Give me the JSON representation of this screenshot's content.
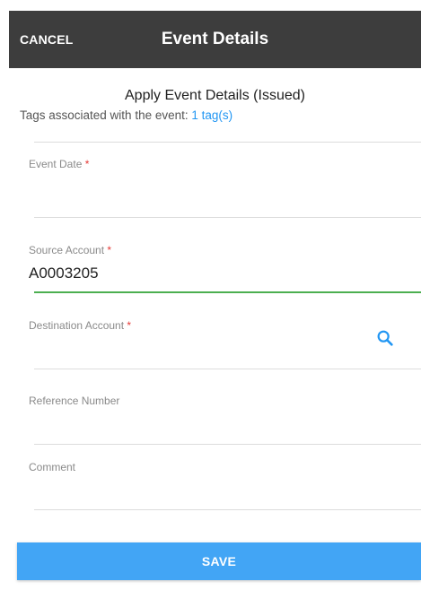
{
  "header": {
    "cancel_label": "CANCEL",
    "title": "Event Details"
  },
  "content": {
    "subtitle": "Apply Event Details (Issued)",
    "tags_prefix": "Tags associated with the event: ",
    "tags_link": "1 tag(s)"
  },
  "fields": {
    "event_date": {
      "label": "Event Date",
      "required_mark": "*",
      "value": ""
    },
    "source_account": {
      "label": "Source Account",
      "required_mark": "*",
      "value": "A0003205"
    },
    "destination_account": {
      "label": "Destination Account",
      "required_mark": "*",
      "value": "",
      "icon": "search-icon"
    },
    "reference_number": {
      "label": "Reference Number",
      "value": ""
    },
    "comment": {
      "label": "Comment",
      "value": ""
    }
  },
  "footer": {
    "save_label": "SAVE"
  },
  "colors": {
    "header_bg": "#3d3d3d",
    "accent": "#2196f3",
    "button": "#42a5f5",
    "active_underline": "#4caf50",
    "required": "#e53935"
  }
}
